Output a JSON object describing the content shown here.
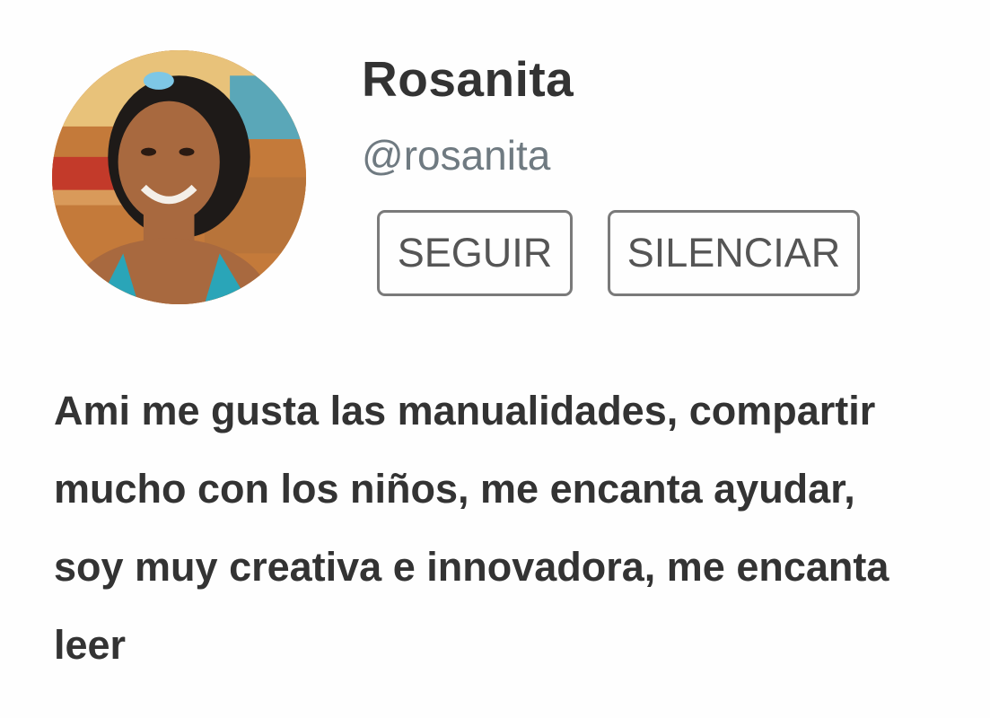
{
  "profile": {
    "display_name": "Rosanita",
    "handle": "@rosanita",
    "avatar_icon": "user-avatar-photo",
    "bio": "Ami me gusta las manualidades, compartir mucho con los niños, me encanta ayudar, soy muy creativa e innovadora, me encanta leer"
  },
  "actions": {
    "follow_label": "SEGUIR",
    "mute_label": "SILENCIAR"
  },
  "colors": {
    "text": "#333333",
    "handle": "#6f7a81",
    "button_border": "#7a7a7a",
    "background": "#fefefe"
  }
}
